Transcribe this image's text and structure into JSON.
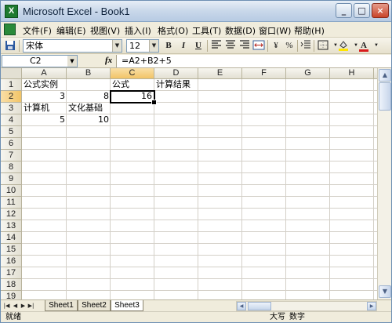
{
  "window": {
    "title": "Microsoft Excel - Book1",
    "app_icon": "X",
    "buttons": [
      "_",
      "□",
      "×"
    ]
  },
  "menu": {
    "items": [
      "文件(F)",
      "编辑(E)",
      "视图(V)",
      "插入(I)",
      "格式(O)",
      "工具(T)",
      "数据(D)",
      "窗口(W)",
      "帮助(H)"
    ]
  },
  "toolbar": {
    "font": "宋体",
    "size": "12",
    "bold": "B",
    "italic": "I",
    "underline": "U",
    "currency": "¥",
    "percent": "%",
    "font_color_icon": "A"
  },
  "formula_bar": {
    "cell_ref": "C2",
    "fx": "fx",
    "formula": "=A2+B2+5"
  },
  "grid": {
    "columns": [
      "A",
      "B",
      "C",
      "D",
      "E",
      "F",
      "G",
      "H"
    ],
    "selected_column": "C",
    "rows": [
      "1",
      "2",
      "3",
      "4",
      "5",
      "6",
      "7",
      "8",
      "9",
      "10",
      "11",
      "12",
      "13",
      "14",
      "15",
      "16",
      "17",
      "18",
      "19"
    ],
    "selected_row": "2",
    "cells": {
      "A1": "公式实例",
      "C1": "公式",
      "D1": "计算结果",
      "A2": "3",
      "B2": "8",
      "C2": "16",
      "A3": "计算机",
      "B3": "文化基础",
      "A4": "5",
      "B4": "10"
    },
    "active_cell": "C2"
  },
  "sheets": {
    "tabs": [
      "Sheet1",
      "Sheet2",
      "Sheet3"
    ],
    "active": "Sheet3"
  },
  "status": {
    "left": "就绪",
    "caps": "大写",
    "num": "数字"
  },
  "colors": {
    "selected_header": "#f2c467",
    "gridline": "#d4d0c8",
    "chrome": "#f0ecdc"
  }
}
